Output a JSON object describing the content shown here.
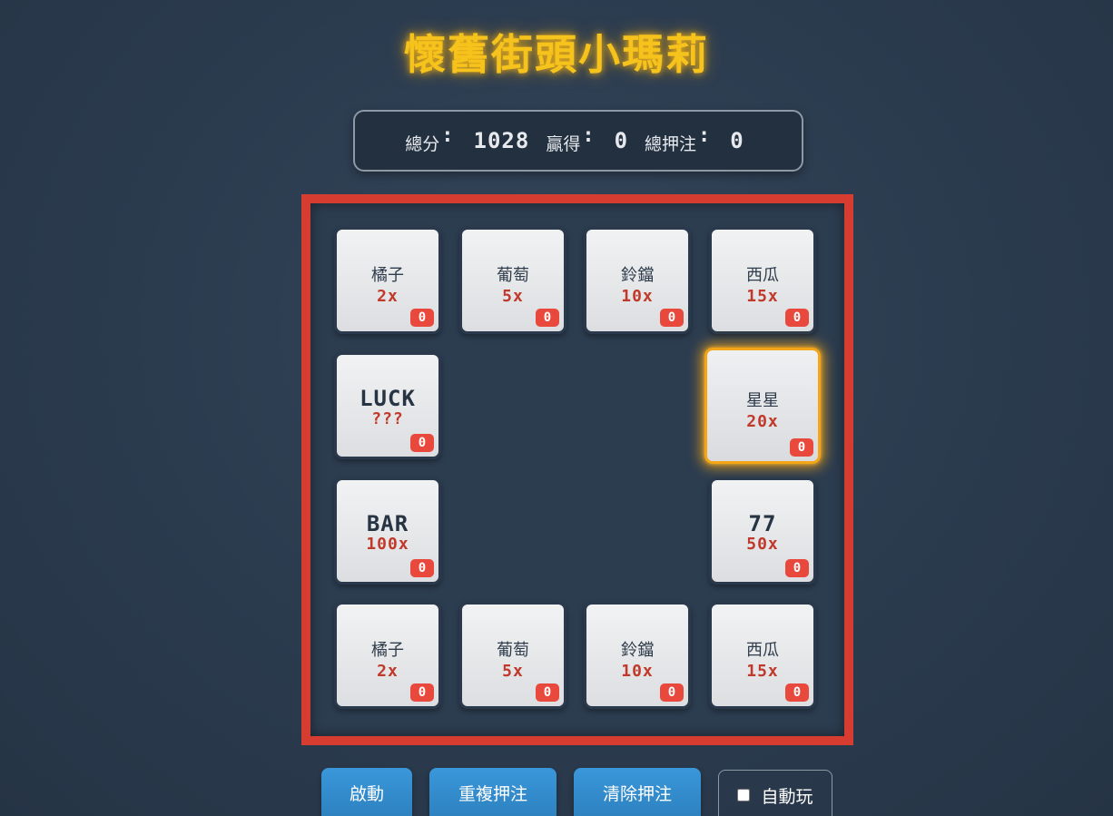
{
  "title": "懷舊街頭小瑪莉",
  "scoreboard": {
    "total_label": "總分",
    "total_value": "1028",
    "win_label": "贏得",
    "win_value": "0",
    "bet_label": "總押注",
    "bet_value": "0",
    "colon": ":"
  },
  "tiles": [
    {
      "name": "橘子",
      "mult": "2x",
      "bet": "0"
    },
    {
      "name": "葡萄",
      "mult": "5x",
      "bet": "0"
    },
    {
      "name": "鈴鐺",
      "mult": "10x",
      "bet": "0"
    },
    {
      "name": "西瓜",
      "mult": "15x",
      "bet": "0"
    },
    {
      "name": "LUCK",
      "mult": "???",
      "bet": "0"
    },
    {
      "name": "星星",
      "mult": "20x",
      "bet": "0",
      "active": true
    },
    {
      "name": "BAR",
      "mult": "100x",
      "bet": "0"
    },
    {
      "name": "77",
      "mult": "50x",
      "bet": "0"
    },
    {
      "name": "橘子",
      "mult": "2x",
      "bet": "0"
    },
    {
      "name": "葡萄",
      "mult": "5x",
      "bet": "0"
    },
    {
      "name": "鈴鐺",
      "mult": "10x",
      "bet": "0"
    },
    {
      "name": "西瓜",
      "mult": "15x",
      "bet": "0"
    }
  ],
  "controls": {
    "start_label": "啟動",
    "repeat_label": "重複押注",
    "clear_label": "清除押注",
    "auto_label": "自動玩",
    "auto_checked": false
  },
  "colors": {
    "title": "#f6c21c",
    "board_border": "#d63c2f",
    "multiplier": "#c0392b",
    "bet_badge": "#e8493c",
    "highlight": "#f5a51a",
    "button": "#3a97da"
  }
}
